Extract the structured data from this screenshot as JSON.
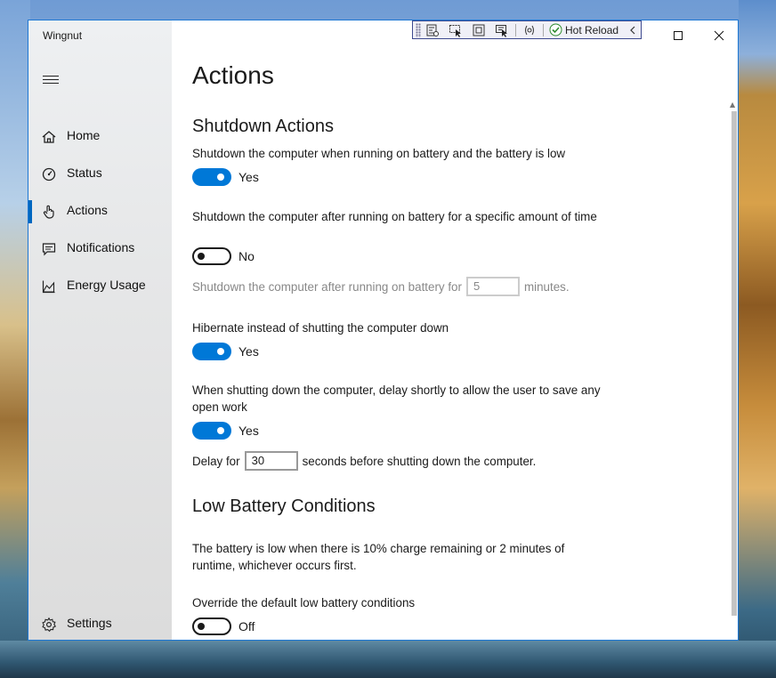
{
  "window": {
    "app_title": "Wingnut"
  },
  "toolbar": {
    "hot_reload_label": "Hot Reload"
  },
  "nav": {
    "items": [
      {
        "label": "Home"
      },
      {
        "label": "Status"
      },
      {
        "label": "Actions"
      },
      {
        "label": "Notifications"
      },
      {
        "label": "Energy Usage"
      }
    ],
    "settings_label": "Settings",
    "selected": "Actions"
  },
  "page": {
    "title": "Actions",
    "shutdown_section": {
      "heading": "Shutdown Actions",
      "battery_low": {
        "label": "Shutdown the computer when running on battery and the battery is low",
        "toggle_state": "on",
        "toggle_text": "Yes"
      },
      "battery_time": {
        "label": "Shutdown the computer after running on battery for a specific amount of time",
        "toggle_state": "off",
        "toggle_text": "No",
        "minutes_prefix": "Shutdown the computer after running on battery for",
        "minutes_value": "5",
        "minutes_suffix": "minutes."
      },
      "hibernate": {
        "label": "Hibernate instead of shutting the computer down",
        "toggle_state": "on",
        "toggle_text": "Yes"
      },
      "delay": {
        "label": "When shutting down the computer, delay shortly to allow the user to save any open work",
        "toggle_state": "on",
        "toggle_text": "Yes",
        "delay_prefix": "Delay for",
        "delay_value": "30",
        "delay_suffix": "seconds before shutting down the computer."
      }
    },
    "low_battery_section": {
      "heading": "Low Battery Conditions",
      "description": "The battery is low when there is 10% charge remaining or 2 minutes of runtime, whichever occurs first.",
      "override": {
        "label": "Override the default low battery conditions",
        "toggle_state": "off",
        "toggle_text": "Off"
      }
    }
  },
  "colors": {
    "accent": "#0078d7",
    "window_border": "#1e78d4"
  }
}
